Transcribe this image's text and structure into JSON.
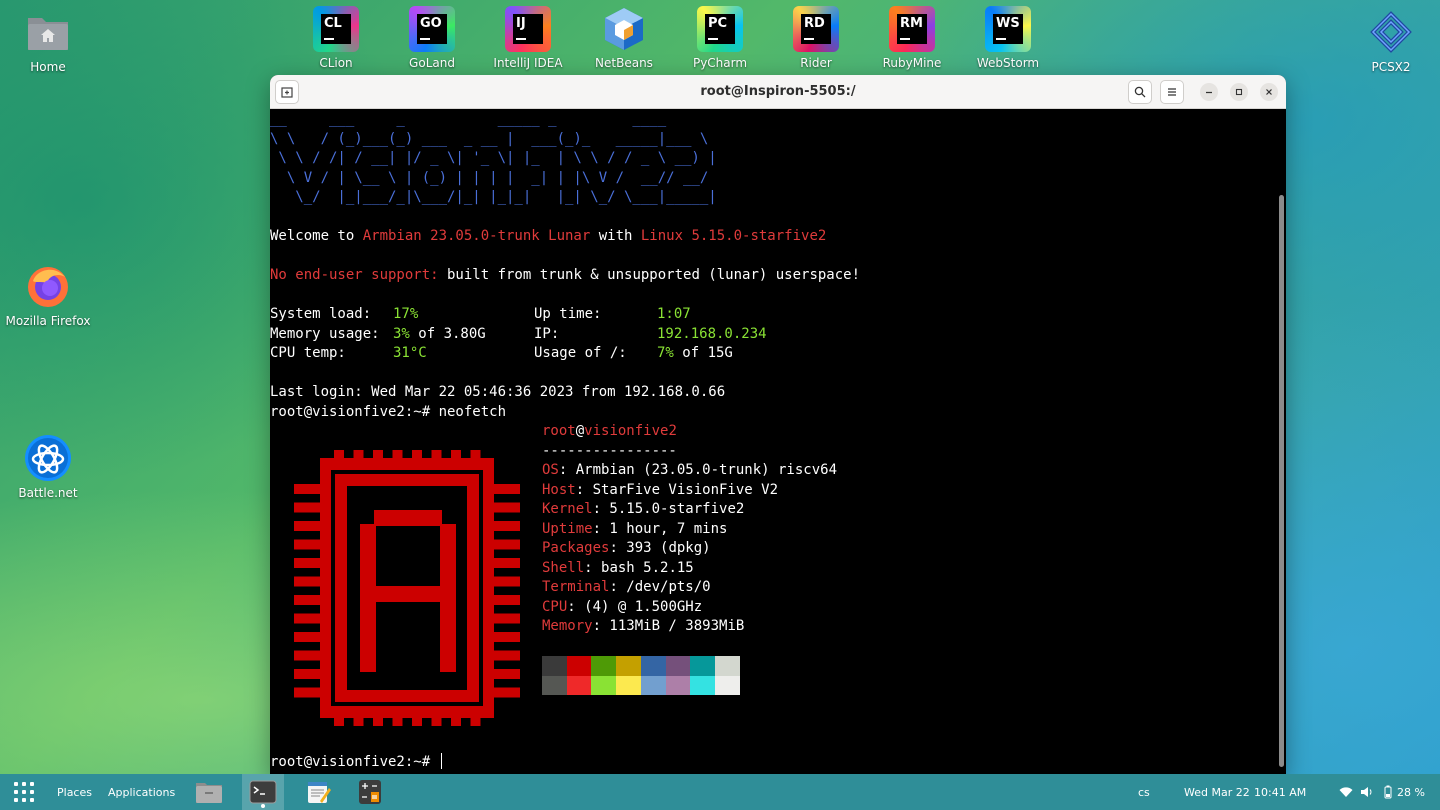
{
  "desktop": {
    "icons": [
      {
        "label": "Home",
        "icon": "home-folder-icon"
      },
      {
        "label": "Mozilla Firefox",
        "icon": "firefox-icon"
      },
      {
        "label": "Battle.net",
        "icon": "battlenet-icon"
      },
      {
        "label": "PCSX2",
        "icon": "pcsx2-icon"
      }
    ],
    "ides": [
      {
        "label": "CLion",
        "abbr": "CL",
        "colors": [
          "#21d789",
          "#009ae5",
          "#ed358c"
        ]
      },
      {
        "label": "GoLand",
        "abbr": "GO",
        "colors": [
          "#0d7bf7",
          "#b74af7",
          "#3bea62"
        ]
      },
      {
        "label": "IntelliJ IDEA",
        "abbr": "IJ",
        "colors": [
          "#fe315d",
          "#7f52ff",
          "#fc801d"
        ]
      },
      {
        "label": "NetBeans",
        "abbr": "",
        "colors": [
          "#1b6ac6",
          "#ffffff",
          "#f0a030"
        ]
      },
      {
        "label": "PyCharm",
        "abbr": "PC",
        "colors": [
          "#21d789",
          "#fcf84a",
          "#07c3f2"
        ]
      },
      {
        "label": "Rider",
        "abbr": "RD",
        "colors": [
          "#dd1265",
          "#fcd34a",
          "#087cfa"
        ]
      },
      {
        "label": "RubyMine",
        "abbr": "RM",
        "colors": [
          "#fe2857",
          "#fc801d",
          "#8b3fe3"
        ]
      },
      {
        "label": "WebStorm",
        "abbr": "WS",
        "colors": [
          "#07c3f2",
          "#087cfa",
          "#fcf84a"
        ]
      }
    ]
  },
  "window": {
    "title": "root@Inspiron-5505:/"
  },
  "terminal": {
    "banner": [
      "__     ___     _           _____ _         ____",
      "\\ \\   / (_)___(_) ___  _ __ |  ___(_)_   _____|___ \\",
      " \\ \\ / /| / __| |/ _ \\| '_ \\| |_  | \\ \\ / / _ \\ __) |",
      "  \\ V / | \\__ \\ | (_) | | | |  _| | |\\ V /  __// __/",
      "   \\_/  |_|___/_|\\___/|_| |_|_|   |_| \\_/ \\___|_____|"
    ],
    "welcome": {
      "prefix": "Welcome to ",
      "distro": "Armbian 23.05.0-trunk Lunar",
      "mid": " with ",
      "kernel": "Linux 5.15.0-starfive2"
    },
    "support": {
      "warn": "No end-user support:",
      "rest": " built from trunk & unsupported (lunar) userspace!"
    },
    "stats": {
      "system_load_label": "System load:",
      "system_load": "17%",
      "up_time_label": "Up time:",
      "up_time": "1:07",
      "memory_label": "Memory usage:",
      "memory": "3%",
      "memory_rest": " of 3.80G",
      "ip_label": "IP:",
      "ip": "192.168.0.234",
      "cpu_temp_label": "CPU temp:",
      "cpu_temp": "31°C",
      "usage_label": "Usage of /:",
      "usage": "7%",
      "usage_rest": " of 15G"
    },
    "last_login": "Last login: Wed Mar 22 05:46:36 2023 from 192.168.0.66",
    "prompt1": "root@visionfive2:~# neofetch",
    "neofetch": {
      "user": "root",
      "at": "@",
      "host": "visionfive2",
      "sep": "----------------",
      "rows": [
        {
          "k": "OS",
          "v": ": Armbian (23.05.0-trunk) riscv64"
        },
        {
          "k": "Host",
          "v": ": StarFive VisionFive V2"
        },
        {
          "k": "Kernel",
          "v": ": 5.15.0-starfive2"
        },
        {
          "k": "Uptime",
          "v": ": 1 hour, 7 mins"
        },
        {
          "k": "Packages",
          "v": ": 393 (dpkg)"
        },
        {
          "k": "Shell",
          "v": ": bash 5.2.15"
        },
        {
          "k": "Terminal",
          "v": ": /dev/pts/0"
        },
        {
          "k": "CPU",
          "v": ": (4) @ 1.500GHz"
        },
        {
          "k": "Memory",
          "v": ": 113MiB / 3893MiB"
        }
      ],
      "palette_top": [
        "#3a3a3a",
        "#cc0000",
        "#4e9a06",
        "#c4a000",
        "#3465a4",
        "#75507b",
        "#06989a",
        "#d3d7cf"
      ],
      "palette_bottom": [
        "#555753",
        "#ef2929",
        "#8ae234",
        "#fce94f",
        "#729fcf",
        "#ad7fa8",
        "#34e2e2",
        "#eeeeec"
      ]
    },
    "prompt2": "root@visionfive2:~# "
  },
  "taskbar": {
    "places": "Places",
    "applications": "Applications",
    "keyboard": "cs",
    "date": "Wed Mar 22",
    "time": "10:41 AM",
    "battery": "28 %"
  }
}
